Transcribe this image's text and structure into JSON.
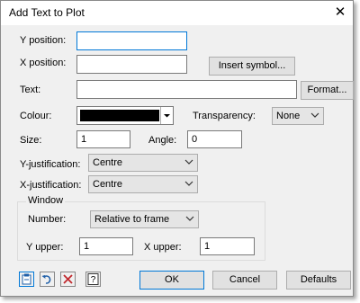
{
  "window": {
    "title": "Add Text to Plot"
  },
  "fields": {
    "y_position": {
      "label": "Y position:",
      "value": ""
    },
    "x_position": {
      "label": "X position:",
      "value": ""
    },
    "text": {
      "label": "Text:",
      "value": ""
    },
    "colour": {
      "label": "Colour:",
      "value": "#000000"
    },
    "transparency": {
      "label": "Transparency:",
      "value": "None"
    },
    "size": {
      "label": "Size:",
      "value": "1"
    },
    "angle": {
      "label": "Angle:",
      "value": "0"
    },
    "y_justification": {
      "label": "Y-justification:",
      "value": "Centre"
    },
    "x_justification": {
      "label": "X-justification:",
      "value": "Centre"
    }
  },
  "window_group": {
    "label": "Window",
    "number": {
      "label": "Number:",
      "value": "Relative to frame"
    },
    "y_upper": {
      "label": "Y upper:",
      "value": "1"
    },
    "x_upper": {
      "label": "X upper:",
      "value": "1"
    }
  },
  "buttons": {
    "insert_symbol": "Insert symbol...",
    "format": "Format...",
    "ok": "OK",
    "cancel": "Cancel",
    "defaults": "Defaults"
  },
  "toolbar_icons": [
    "clipboard-icon",
    "undo-icon",
    "clear-icon",
    "help-icon"
  ],
  "colors": {
    "focus_border": "#0078d7",
    "dialog_bg": "#f0f0f0"
  }
}
